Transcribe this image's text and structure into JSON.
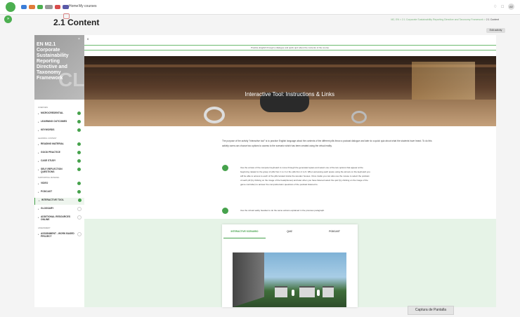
{
  "topbar": {
    "nav_home": "Home",
    "nav_my_courses": "My courses",
    "avatar_initials": "AE"
  },
  "page": {
    "title": "2.1 Content",
    "breadcrumb_trail": "M2, EN  >  2.1 Corporate Sustainability Reporting Directive and Taxonomy Framework  >",
    "breadcrumb_current": "2.1 Content",
    "edit_button": "Edit activity"
  },
  "course": {
    "name": "EN M2.1 Corporate Sustainability Reporting Directive and Taxonomy Framework",
    "close": "×",
    "ghost": "CL"
  },
  "sidebar": {
    "items": [
      {
        "label": "OVERVIEW",
        "type": "section"
      },
      {
        "label": "MICROCREDENTIAL",
        "type": "item",
        "done": true
      },
      {
        "label": "LEARNING OUTCOMES",
        "type": "item",
        "done": true
      },
      {
        "label": "KEYWORDS",
        "type": "item",
        "done": true
      },
      {
        "label": "LEARNING CONTENT",
        "type": "section"
      },
      {
        "label": "READING MATERIAL",
        "type": "item",
        "done": true
      },
      {
        "label": "GOOD PRACTICE",
        "type": "item",
        "done": true
      },
      {
        "label": "CASE STUDY",
        "type": "item",
        "done": true
      },
      {
        "label": "SELF-REFLECTION QUESTIONS",
        "type": "item",
        "done": true
      },
      {
        "label": "SUPPORTING MATERIAL",
        "type": "section"
      },
      {
        "label": "VIDEO",
        "type": "item",
        "done": true
      },
      {
        "label": "PODCAST",
        "type": "item",
        "done": true
      },
      {
        "label": "INTERACTIVE TOOL",
        "type": "item",
        "done": true,
        "active": true
      },
      {
        "label": "GLOSSARY",
        "type": "item",
        "done": false
      },
      {
        "label": "ADDITIONAL RESOURCES ONLINE",
        "type": "item",
        "done": false
      },
      {
        "label": "ASSESSMENT",
        "type": "section"
      },
      {
        "label": "ASSIGNMENT - WORK BASED PROJECT",
        "type": "item",
        "done": false
      }
    ]
  },
  "content": {
    "section_number": "0",
    "banner_text": "Practice English through a dialogue and quick quiz about the contents of the course.",
    "hero_title": "Interactive Tool: Instructions & Links",
    "intro": "The purpose of the activity \"interactive tool\" is to practice English language about the contents of the different pills throw a podcast dialogue and later do a quick quiz about what the students have heard. To do this activity users can choose two options to access to the scenario which has been created using the virtual reality.",
    "step1": "Use the arrows of the computer keyboard to move through the generated space and select one of the two options that appear at the beginning related to the group of pills from 1 to 3 or the pills from 4 to 9. When accessing each space using the arrows on the keyboard you will be able to access to each of the pills located inside the wooden houses. Once inside you can also use the mouse to select the podcast of each pill (by clicking on the image of the headphones) and later when you have listened select the quiz (by clicking on the image of the game controller) to answer the comprehension questions of the podcast listened to.",
    "step2": "Use the virtual reality headset to do the same actions explained in the previous paragraph.",
    "tabs": [
      "INTERACTIVE SCENARIO",
      "QUIZ",
      "PODCAST"
    ]
  },
  "overlay": {
    "screenshot_label": "Captura de Pantalla"
  },
  "colors": {
    "accent": "#46a24c",
    "tool_area": "#e6f3e7"
  }
}
